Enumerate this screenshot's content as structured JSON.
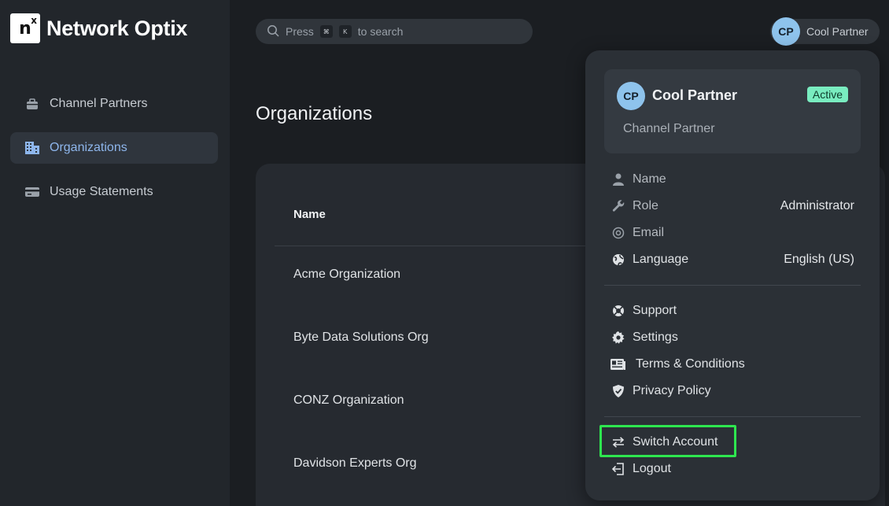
{
  "brand": {
    "logo_letter": "n",
    "logo_sup": "x",
    "name": "Network Optix"
  },
  "sidebar": {
    "items": [
      {
        "label": "Channel Partners",
        "icon": "briefcase-icon",
        "active": false
      },
      {
        "label": "Organizations",
        "icon": "building-icon",
        "active": true
      },
      {
        "label": "Usage Statements",
        "icon": "credit-card-icon",
        "active": false
      }
    ]
  },
  "search": {
    "prefix": "Press",
    "key1": "⌘",
    "key2": "K",
    "suffix": "to search"
  },
  "user_chip": {
    "initials": "CP",
    "name": "Cool Partner"
  },
  "main": {
    "title": "Organizations",
    "table": {
      "headers": [
        "Name"
      ],
      "rows": [
        "Acme Organization",
        "Byte Data Solutions Org",
        "CONZ Organization",
        "Davidson Experts Org"
      ]
    }
  },
  "menu": {
    "profile": {
      "initials": "CP",
      "name": "Cool Partner",
      "status": "Active",
      "role_type": "Channel Partner"
    },
    "info": [
      {
        "label": "Name",
        "value": "",
        "icon": "user-icon"
      },
      {
        "label": "Role",
        "value": "Administrator",
        "icon": "wrench-icon"
      },
      {
        "label": "Email",
        "value": "",
        "icon": "at-icon"
      },
      {
        "label": "Language",
        "value": "English (US)",
        "icon": "globe-icon"
      }
    ],
    "links": [
      {
        "label": "Support",
        "icon": "lifebuoy-icon"
      },
      {
        "label": "Settings",
        "icon": "gear-icon"
      },
      {
        "label": "Terms & Conditions",
        "icon": "newspaper-icon"
      },
      {
        "label": "Privacy Policy",
        "icon": "shield-icon"
      }
    ],
    "actions": [
      {
        "label": "Switch Account",
        "icon": "swap-icon"
      },
      {
        "label": "Logout",
        "icon": "logout-icon"
      }
    ]
  },
  "colors": {
    "background": "#1b1e22",
    "accent": "#8eb6ec",
    "badge": "#79ecc0",
    "highlight": "#2ee64f"
  }
}
